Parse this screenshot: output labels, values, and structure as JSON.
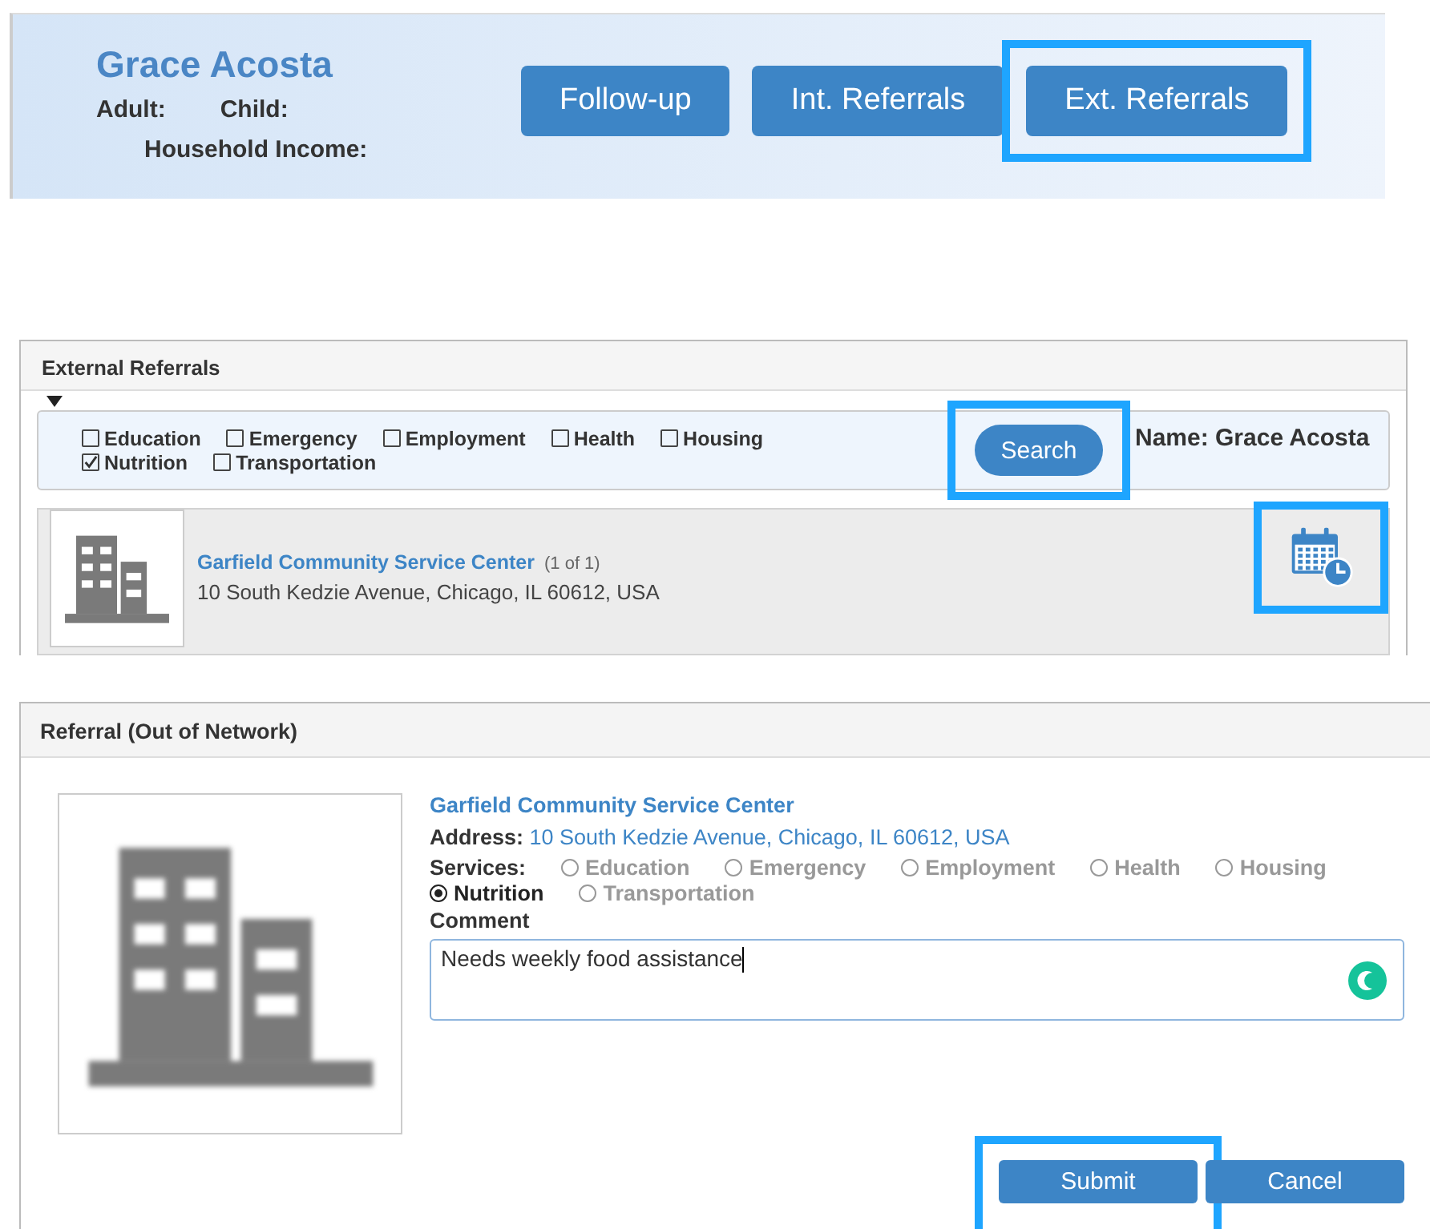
{
  "header": {
    "name": "Grace Acosta",
    "fields": [
      {
        "label": "Adult:"
      },
      {
        "label": "Child:"
      },
      {
        "label": "Household Income:"
      }
    ],
    "buttons": [
      {
        "label": "Follow-up",
        "highlighted": false
      },
      {
        "label": "Int. Referrals",
        "highlighted": false
      },
      {
        "label": "Ext. Referrals",
        "highlighted": true
      }
    ]
  },
  "external_referrals": {
    "title": "External Referrals",
    "categories": [
      {
        "label": "Education",
        "checked": false
      },
      {
        "label": "Emergency",
        "checked": false
      },
      {
        "label": "Employment",
        "checked": false
      },
      {
        "label": "Health",
        "checked": false
      },
      {
        "label": "Housing",
        "checked": false
      },
      {
        "label": "Nutrition",
        "checked": true
      },
      {
        "label": "Transportation",
        "checked": false
      }
    ],
    "search_button": {
      "label": "Search",
      "highlighted": true
    },
    "name_label": "Name: Grace Acosta",
    "results": [
      {
        "name": "Garfield Community Service Center",
        "count": "(1 of 1)",
        "address": "10 South Kedzie Avenue, Chicago, IL 60612, USA",
        "schedule_highlighted": true
      }
    ]
  },
  "referral_dialog": {
    "title": "Referral (Out of Network)",
    "org_name": "Garfield Community Service Center",
    "address_label": "Address:",
    "address": "10 South Kedzie Avenue, Chicago, IL 60612, USA",
    "services_label": "Services:",
    "services": [
      {
        "label": "Education",
        "selected": false
      },
      {
        "label": "Emergency",
        "selected": false
      },
      {
        "label": "Employment",
        "selected": false
      },
      {
        "label": "Health",
        "selected": false
      },
      {
        "label": "Housing",
        "selected": false
      },
      {
        "label": "Nutrition",
        "selected": true
      },
      {
        "label": "Transportation",
        "selected": false
      }
    ],
    "comment_label": "Comment",
    "comment": "Needs weekly food assistance",
    "buttons": [
      {
        "label": "Submit",
        "highlighted": true
      },
      {
        "label": "Cancel",
        "highlighted": false
      }
    ]
  }
}
